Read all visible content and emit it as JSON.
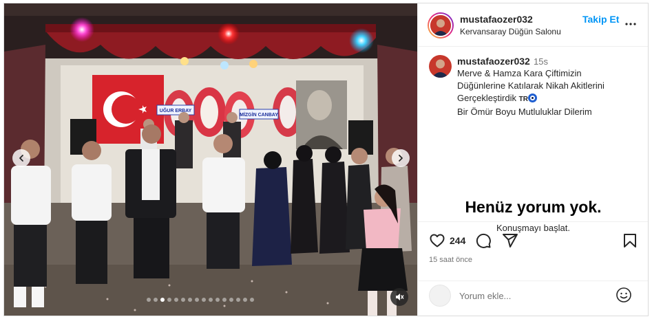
{
  "post": {
    "username": "mustafaozer032",
    "location": "Kervansaray Düğün Salonu",
    "follow_label": "Takip Et",
    "caption_time": "15s",
    "caption_lines": [
      "Merve & Hamza Kara Çiftimizin",
      "Düğünlerine Katılarak Nikah Akitlerini",
      "Gerçekleştirdik"
    ],
    "caption_flag": "TR",
    "caption_last": "Bir Ömür Boyu Mutluluklar Dilerim",
    "likes": "244",
    "time_ago": "15 saat önce"
  },
  "comments": {
    "empty_title": "Henüz yorum yok.",
    "empty_sub": "Konuşmayı başlat.",
    "input_placeholder": "Yorum ekle..."
  },
  "media": {
    "banner_texts": [
      "UĞUR ERBAY",
      "MİZGİN CANBAY"
    ],
    "carousel_count": 16,
    "carousel_active": 2
  },
  "icons": [
    "more-options-icon",
    "heart-icon",
    "comment-icon",
    "share-icon",
    "bookmark-icon",
    "emoji-icon",
    "chevron-left-icon",
    "chevron-right-icon",
    "mute-icon"
  ],
  "colors": {
    "accent": "#0095f6",
    "text": "#262626",
    "muted": "#737373",
    "border": "#dbdbdb"
  }
}
